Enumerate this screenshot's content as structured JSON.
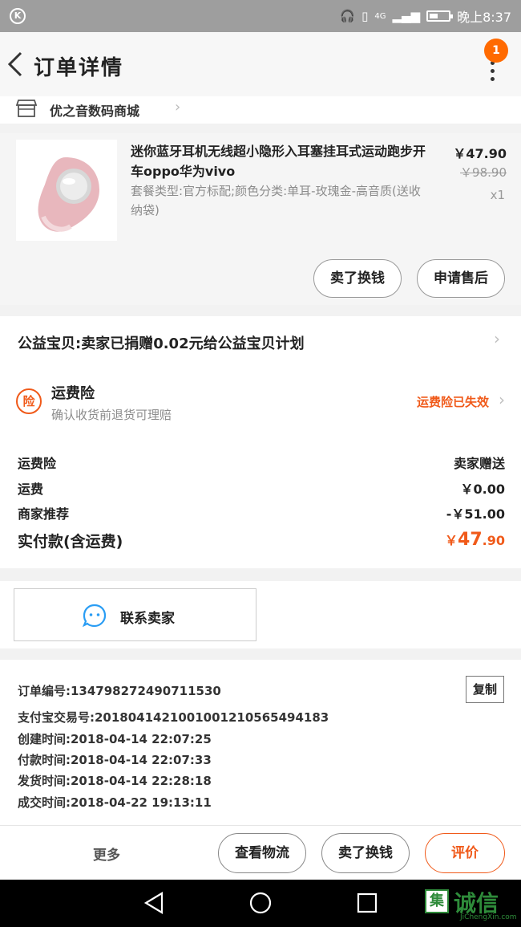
{
  "status_bar": {
    "app_icon": "K",
    "network": "4G",
    "time": "晚上8:37"
  },
  "header": {
    "title": "订单详情",
    "badge_count": "1"
  },
  "shop": {
    "name": "优之音数码商城"
  },
  "product": {
    "title": "迷你蓝牙耳机无线超小隐形入耳塞挂耳式运动跑步开车oppo华为vivo",
    "sku": "套餐类型:官方标配;颜色分类:单耳-玫瑰金-高音质(送收纳袋)",
    "price": "￥47.90",
    "original_price": "￥98.90",
    "quantity": "x1",
    "refund_button": "卖了换钱",
    "aftersale_button": "申请售后"
  },
  "charity": {
    "text": "公益宝贝:卖家已捐赠0.02元给公益宝贝计划"
  },
  "insurance": {
    "icon_char": "险",
    "title": "运费险",
    "subtitle": "确认收货前退货可理赔",
    "status": "运费险已失效"
  },
  "fees": {
    "rows": [
      {
        "label": "运费险",
        "value": "卖家赠送"
      },
      {
        "label": "运费",
        "value": "￥0.00"
      },
      {
        "label": "商家推荐",
        "value": "-￥51.00"
      }
    ],
    "total_label": "实付款(含运费)",
    "total_currency": "￥",
    "total_integer": "47",
    "total_decimal": ".90"
  },
  "contact": {
    "label": "联系卖家"
  },
  "order_info": {
    "copy_label": "复制",
    "rows": [
      "订单编号:134798272490711530",
      "支付宝交易号:2018041421001001210565494183",
      "创建时间:2018-04-14 22:07:25",
      "付款时间:2018-04-14 22:07:33",
      "发货时间:2018-04-14 22:28:18",
      "成交时间:2018-04-22 19:13:11"
    ]
  },
  "bottom_bar": {
    "more_label": "更多",
    "logistics_button": "查看物流",
    "sell_button": "卖了换钱",
    "review_button": "评价"
  },
  "watermark": {
    "box_char": "集",
    "text": "诚信",
    "url": "JiChengXin.com"
  },
  "colors": {
    "accent": "#f05a1a",
    "badge": "#ff6a00",
    "status_bar": "#9e9e9e"
  }
}
